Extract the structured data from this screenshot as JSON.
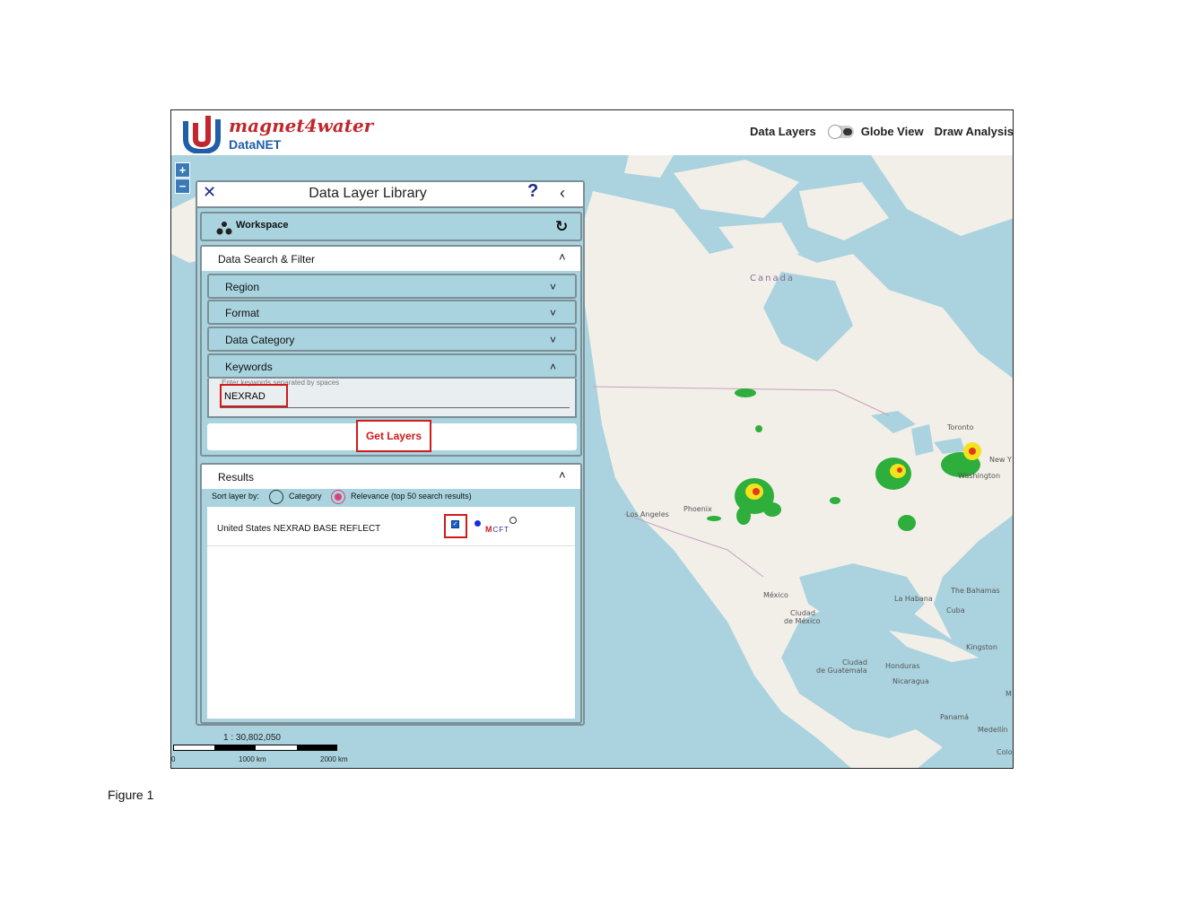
{
  "app": {
    "brand_name": "magnet4water",
    "brand_sub": "DataNET",
    "nav": {
      "data_layers": "Data Layers",
      "globe_view": "Globe View",
      "draw_analysis": "Draw Analysis A"
    },
    "globe_view_enabled": false
  },
  "zoom": {
    "in_label": "+",
    "out_label": "−"
  },
  "panel": {
    "close_label": "✕",
    "title": "Data Layer Library",
    "help_label": "?",
    "collapse_label": "‹",
    "workspace": {
      "label": "Workspace",
      "refresh_label": "↻"
    },
    "search": {
      "title": "Data Search & Filter",
      "chevron_open": "˄",
      "filters": [
        {
          "label": "Region",
          "chevron": "˅"
        },
        {
          "label": "Format",
          "chevron": "˅"
        },
        {
          "label": "Data Category",
          "chevron": "˅"
        },
        {
          "label": "Keywords",
          "chevron": "˄"
        }
      ],
      "keywords_placeholder": "Enter keywords separated by spaces",
      "keywords_value": "NEXRAD",
      "get_layers_label": "Get Layers"
    },
    "results": {
      "title": "Results",
      "chevron": "˄",
      "sort_label": "Sort layer by:",
      "sort_options": [
        "Category",
        "Relevance (top 50 search results)"
      ],
      "sort_selected": "Relevance (top 50 search results)",
      "items": [
        {
          "name": "United States NEXRAD BASE REFLECT",
          "checked": true,
          "badge_m": "M",
          "badge_rest": "CFT"
        }
      ]
    }
  },
  "map": {
    "labels": {
      "canada": "Canada",
      "toronto": "Toronto",
      "washington": "Washington",
      "new_york": "New Y",
      "los_angeles": "Los Angeles",
      "phoenix": "Phoenix",
      "mexico": "México",
      "ciudad_de_mexico_1": "Ciudad",
      "ciudad_de_mexico_2": "de México",
      "la_habana": "La Habana",
      "the_bahamas": "The Bahamas",
      "cuba": "Cuba",
      "kingston": "Kingston",
      "ciudad_de_guatemala_1": "Ciudad",
      "ciudad_de_guatemala_2": "de Guatemala",
      "honduras": "Honduras",
      "nicaragua": "Nicaragua",
      "panama": "Panamá",
      "medellin": "Medellín",
      "col": "Colo",
      "m": "M"
    },
    "scale_ratio": "1 : 30,802,050",
    "scale_labels": [
      "0",
      "1000 km",
      "2000 km"
    ]
  },
  "figure_caption": "Figure 1",
  "colors": {
    "ocean": "#aad3df",
    "land": "#f2efe9",
    "panel": "#a9d3de",
    "highlight": "#d11a1a",
    "brand_red": "#c1272d",
    "brand_blue": "#1f5fa8"
  }
}
